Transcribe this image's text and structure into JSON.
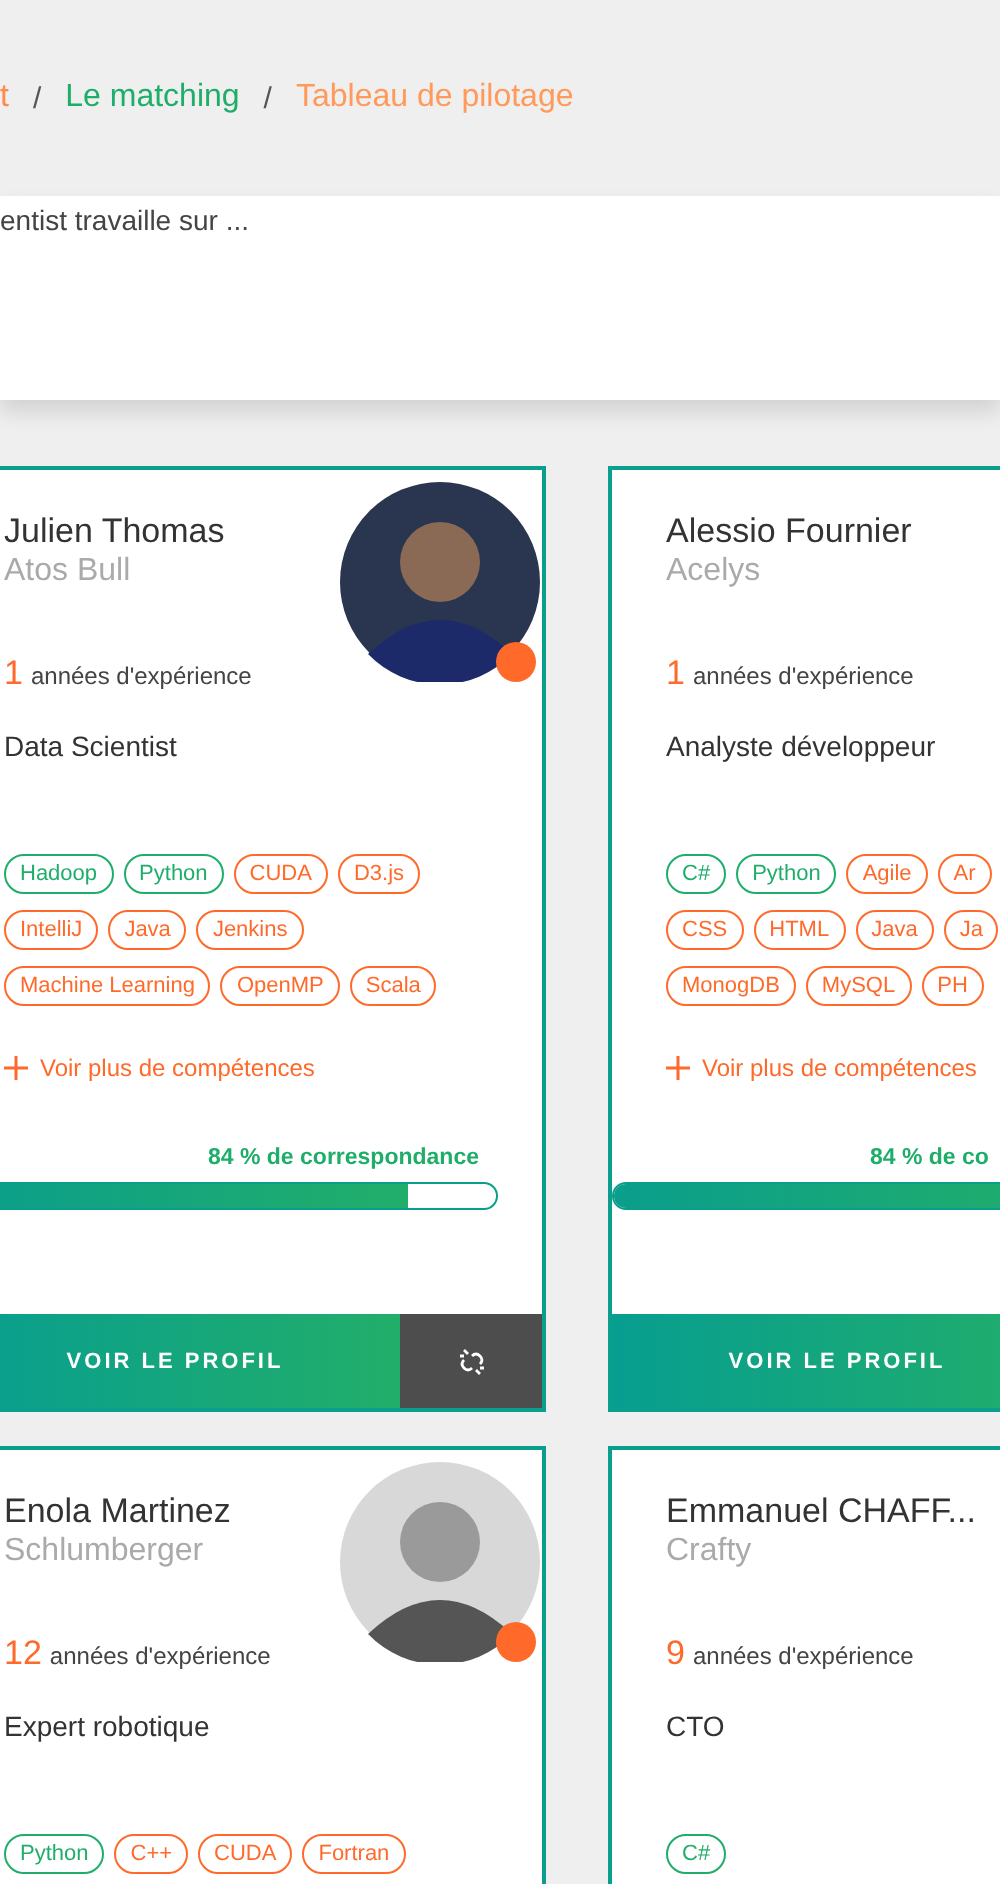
{
  "breadcrumb": [
    {
      "kind": "link",
      "text": "t",
      "color": "#ff8a4c"
    },
    {
      "kind": "separator",
      "text": "/"
    },
    {
      "kind": "link",
      "text": "Le matching",
      "color": "#1fae6a"
    },
    {
      "kind": "separator",
      "text": "/"
    },
    {
      "kind": "link",
      "text": "Tableau de pilotage",
      "color": "#ff9a5c"
    }
  ],
  "search": {
    "value": "entist travaille sur ..."
  },
  "cards": [
    {
      "name": "Julien Thomas",
      "company": "Atos Bull",
      "years": "1",
      "years_label": "années d'expérience",
      "title": "Data Scientist",
      "avatar": {
        "online": true
      },
      "skills": [
        [
          {
            "label": "Hadoop",
            "matched": true
          },
          {
            "label": "Python",
            "matched": true
          },
          {
            "label": "CUDA",
            "matched": false
          },
          {
            "label": "D3.js",
            "matched": false
          }
        ],
        [
          {
            "label": "IntelliJ",
            "matched": false
          },
          {
            "label": "Java",
            "matched": false
          },
          {
            "label": "Jenkins",
            "matched": false
          }
        ],
        [
          {
            "label": "Machine Learning",
            "matched": false
          },
          {
            "label": "OpenMP",
            "matched": false
          },
          {
            "label": "Scala",
            "matched": false
          }
        ]
      ],
      "more": "Voir plus de compétences",
      "match": "84 % de correspondance",
      "level": 0.84,
      "profile_button": "VOIR LE PROFIL",
      "unlink_button": true
    },
    {
      "name": "Alessio Fournier",
      "company": "Acelys",
      "years": "1",
      "years_label": "années d'expérience",
      "title": "Analyste développeur",
      "skills": [
        [
          {
            "label": "C#",
            "matched": true
          },
          {
            "label": "Python",
            "matched": true
          },
          {
            "label": "Agile",
            "matched": false
          },
          {
            "label": "Ar",
            "matched": false
          }
        ],
        [
          {
            "label": "CSS",
            "matched": false
          },
          {
            "label": "HTML",
            "matched": false
          },
          {
            "label": "Java",
            "matched": false
          },
          {
            "label": "Ja",
            "matched": false
          }
        ],
        [
          {
            "label": "MonogDB",
            "matched": false
          },
          {
            "label": "MySQL",
            "matched": false
          },
          {
            "label": "PH",
            "matched": false
          }
        ]
      ],
      "more": "Voir plus de compétences",
      "match": "84 % de co",
      "level": 0.84,
      "profile_button": "VOIR LE PROFIL"
    },
    {
      "name": "Enola Martinez",
      "company": "Schlumberger",
      "years": "12",
      "years_label": "années d'expérience",
      "title": "Expert robotique",
      "avatar": {
        "online": true
      },
      "skills": [
        [
          {
            "label": "Python",
            "matched": true
          },
          {
            "label": "C++",
            "matched": false
          },
          {
            "label": "CUDA",
            "matched": false
          },
          {
            "label": "Fortran",
            "matched": false
          }
        ]
      ]
    },
    {
      "name": "Emmanuel CHAFF...",
      "company": "Crafty",
      "years": "9",
      "years_label": "années d'expérience",
      "title": "CTO",
      "skills": [
        [
          {
            "label": "C#",
            "matched": true
          }
        ]
      ]
    }
  ]
}
